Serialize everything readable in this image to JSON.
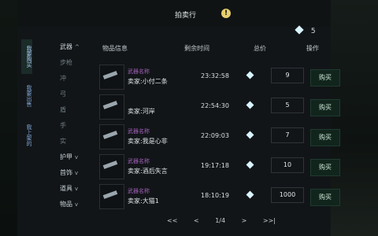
{
  "window": {
    "title": "拍卖行"
  },
  "currency": {
    "amount": "5"
  },
  "vertical_tabs": [
    {
      "label": "我要购买",
      "active": true
    },
    {
      "label": "我要出售",
      "active": false
    },
    {
      "label": "我上架的",
      "active": false
    }
  ],
  "categories": [
    {
      "label": "武器",
      "type": "header"
    },
    {
      "label": "步枪",
      "type": "sub"
    },
    {
      "label": "冲",
      "type": "sub"
    },
    {
      "label": "弓",
      "type": "sub"
    },
    {
      "label": "盾",
      "type": "sub"
    },
    {
      "label": "手",
      "type": "sub"
    },
    {
      "label": "实",
      "type": "sub"
    },
    {
      "label": "护甲",
      "type": "header"
    },
    {
      "label": "首饰",
      "type": "header"
    },
    {
      "label": "道具",
      "type": "header"
    },
    {
      "label": "物品",
      "type": "header"
    }
  ],
  "table": {
    "columns": [
      "物品信息",
      "剩余时间",
      "总价",
      "操作"
    ],
    "rows": [
      {
        "name": "武器名称",
        "seller": "卖家:小付二条",
        "time": "23:32:58",
        "price": "9",
        "action": "购买"
      },
      {
        "name": "",
        "seller": "卖家:河岸",
        "time": "22:54:30",
        "price": "5",
        "action": "购买"
      },
      {
        "name": "武器名称",
        "seller": "卖家:我是心非",
        "time": "22:09:03",
        "price": "7",
        "action": "购买"
      },
      {
        "name": "武器名称",
        "seller": "卖家:酒后失言",
        "time": "19:17:18",
        "price": "10",
        "action": "购买"
      },
      {
        "name": "武器名称",
        "seller": "卖家:大猫1",
        "time": "18:10:19",
        "price": "1000",
        "action": "购买"
      }
    ]
  },
  "pager": {
    "first": "<<",
    "prev": "<",
    "page": "1/4",
    "next": ">",
    "last": ">>|"
  }
}
